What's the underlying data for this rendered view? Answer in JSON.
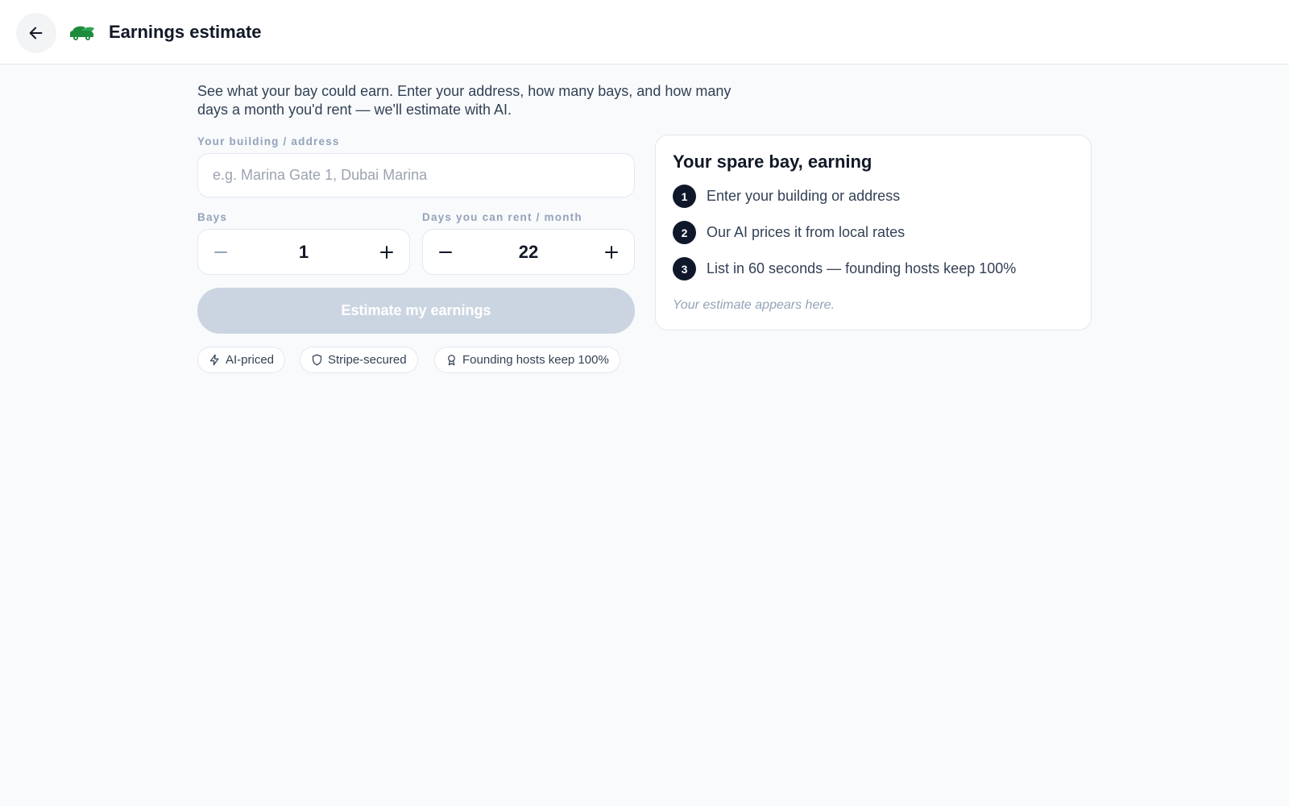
{
  "header": {
    "title": "Earnings estimate",
    "back_icon": "arrow-left-icon",
    "logo_icon": "car-leaf-logo",
    "logo_color": "#1e8a3c"
  },
  "intro": "See what your bay could earn. Enter your address, how many bays, and how many days a month you'd rent — we'll estimate with AI.",
  "form": {
    "address": {
      "label": "Your building / address",
      "value": "",
      "placeholder": "e.g. Marina Gate 1, Dubai Marina"
    },
    "bays": {
      "label": "Bays",
      "value": "1",
      "decrement_icon": "minus-icon",
      "increment_icon": "plus-icon"
    },
    "days": {
      "label": "Days you can rent / month",
      "value": "22",
      "decrement_icon": "minus-icon",
      "increment_icon": "plus-icon"
    },
    "submit_label": "Estimate my earnings",
    "submit_color": "#cbd5e1"
  },
  "chips": [
    {
      "label": "AI-priced",
      "icon": "lightning-icon"
    },
    {
      "label": "Stripe-secured",
      "icon": "shield-icon"
    },
    {
      "label": "Founding hosts keep 100%",
      "icon": "award-icon"
    }
  ],
  "card": {
    "title": "Your spare bay, earning",
    "steps": [
      {
        "num": "1",
        "text": "Enter your building or address"
      },
      {
        "num": "2",
        "text": "Our AI prices it from local rates"
      },
      {
        "num": "3",
        "text": "List in 60 seconds — founding hosts keep 100%"
      }
    ],
    "note": "Your estimate appears here."
  }
}
